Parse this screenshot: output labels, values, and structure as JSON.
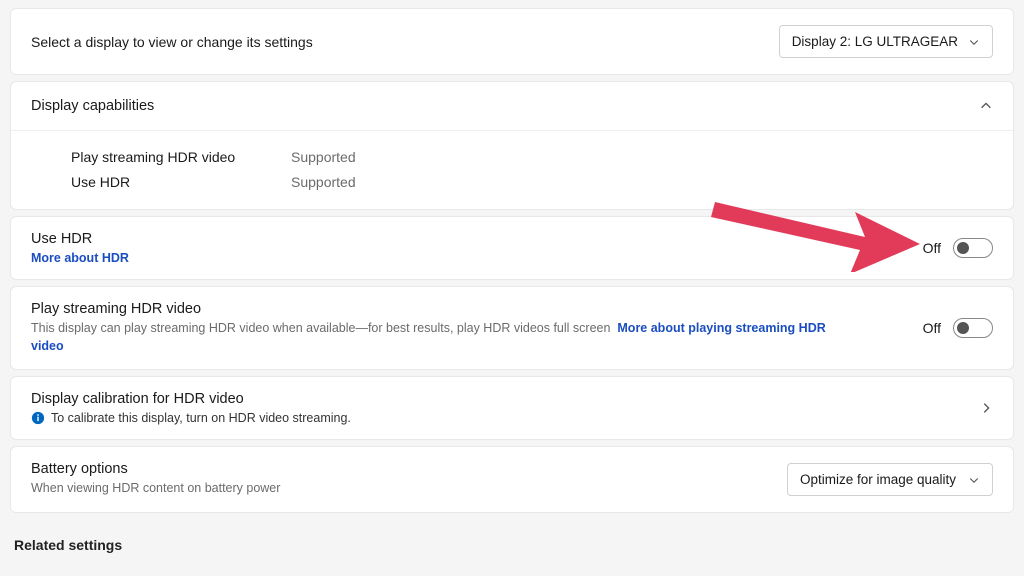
{
  "selectDisplay": {
    "prompt": "Select a display to view or change its settings",
    "selected": "Display 2: LG ULTRAGEAR"
  },
  "capabilities": {
    "heading": "Display capabilities",
    "rows": [
      {
        "label": "Play streaming HDR video",
        "value": "Supported"
      },
      {
        "label": "Use HDR",
        "value": "Supported"
      }
    ]
  },
  "useHdr": {
    "title": "Use HDR",
    "link": "More about HDR",
    "toggle": "Off"
  },
  "playStream": {
    "title": "Play streaming HDR video",
    "desc": "This display can play streaming HDR video when available—for best results, play HDR videos full screen",
    "link": "More about playing streaming HDR video",
    "toggle": "Off"
  },
  "calibration": {
    "title": "Display calibration for HDR video",
    "info": "To calibrate this display, turn on HDR video streaming."
  },
  "battery": {
    "title": "Battery options",
    "desc": "When viewing HDR content on battery power",
    "selected": "Optimize for image quality"
  },
  "related": "Related settings"
}
